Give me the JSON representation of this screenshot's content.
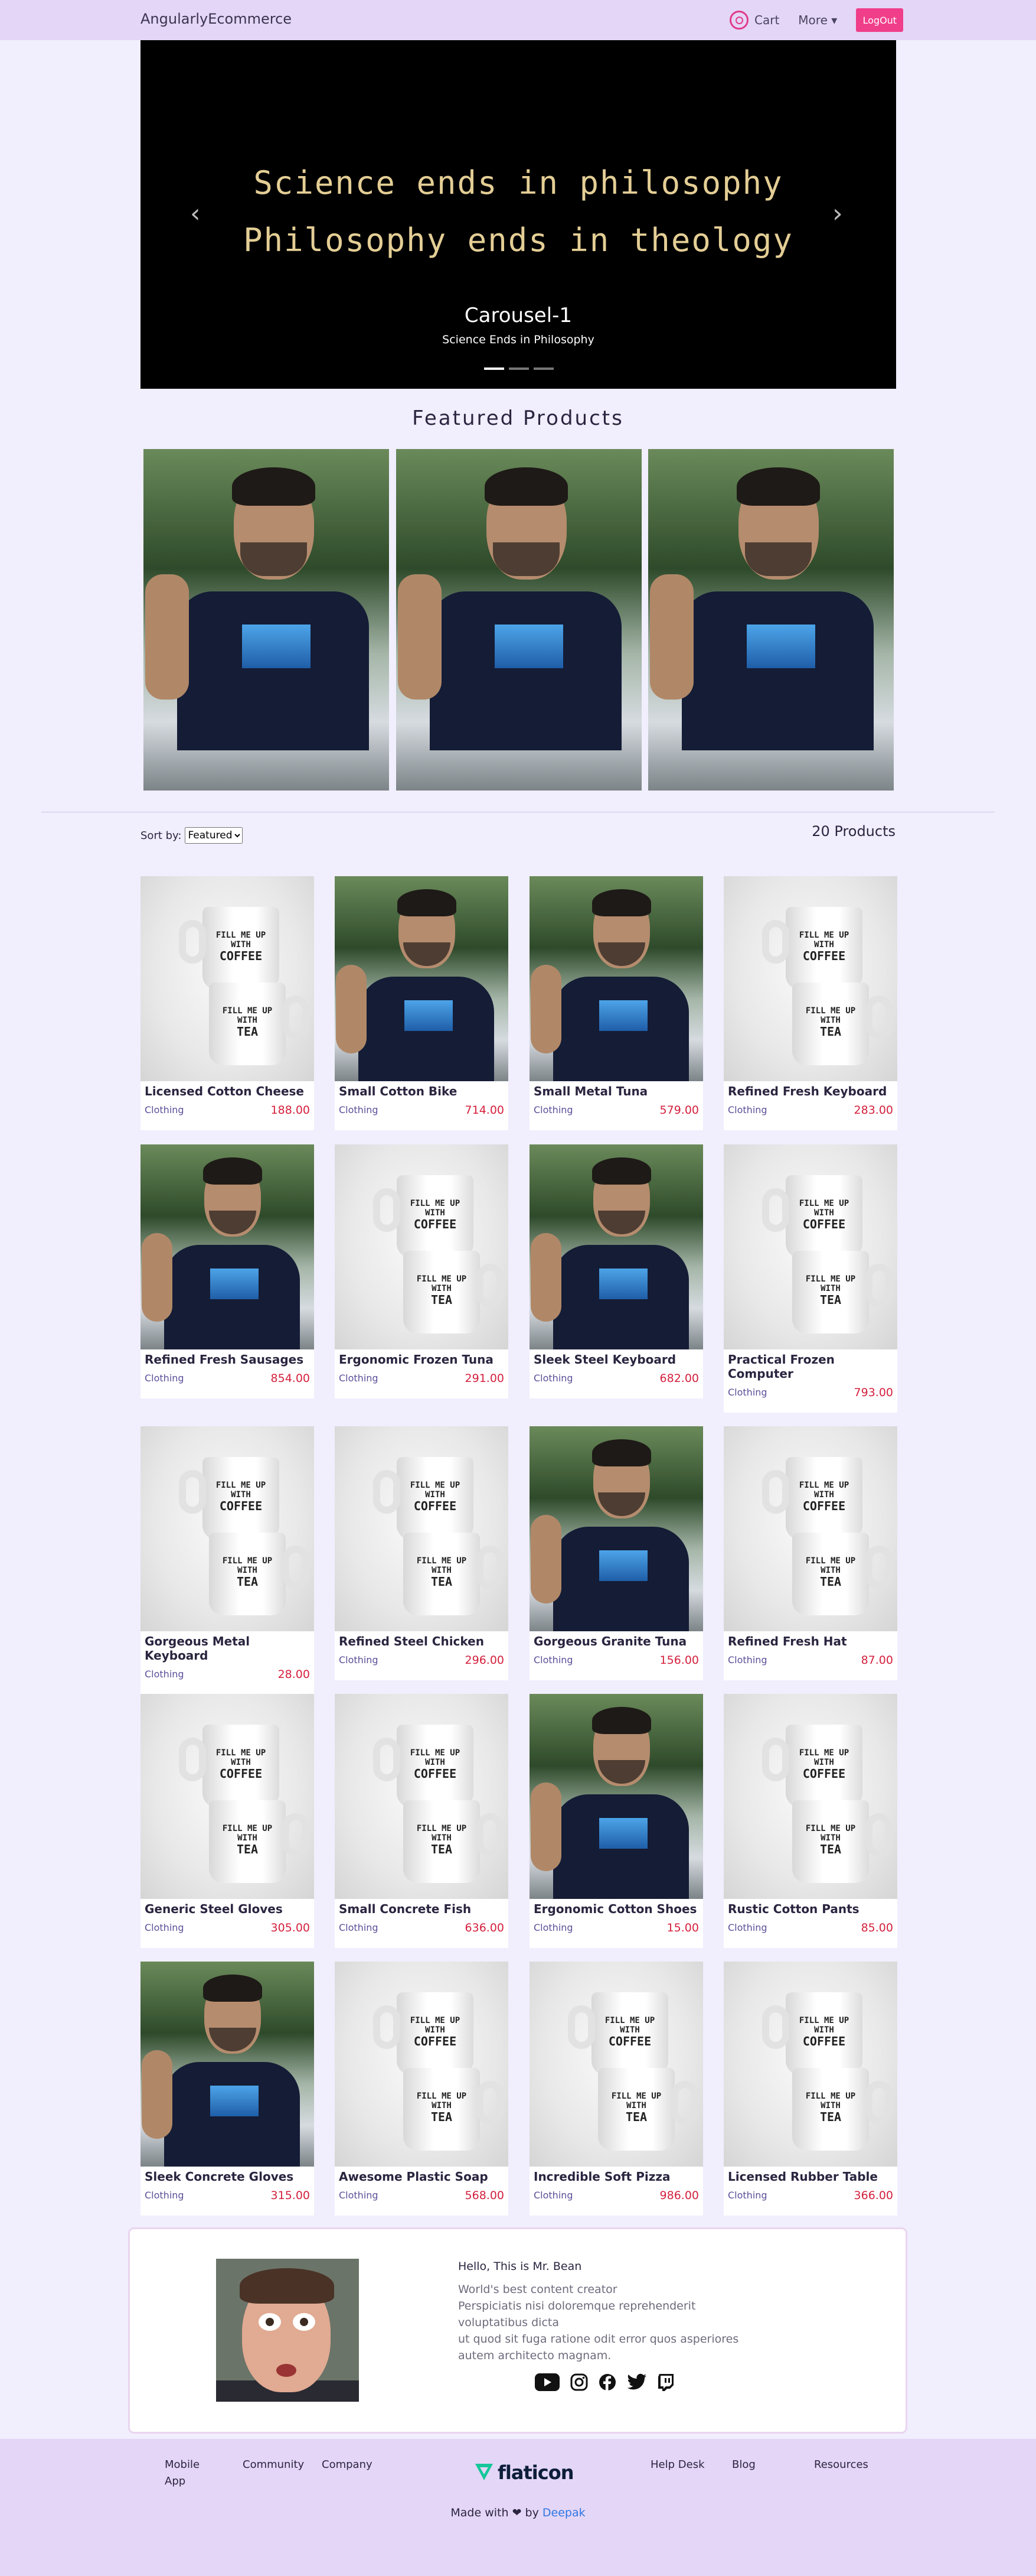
{
  "navbar": {
    "brand": "AngularlyEcommerce",
    "cart_label": "Cart",
    "more_label": "More ▾",
    "logout_label": "LogOut"
  },
  "carousel": {
    "line1": "Science ends in philosophy",
    "line2": "Philosophy ends in theology",
    "title": "Carousel-1",
    "subtitle": "Science Ends in Philosophy",
    "prev": "‹",
    "next": "›",
    "indicators": 3,
    "active_indicator": 1
  },
  "featured": {
    "title": "Featured Products",
    "items": [
      {
        "image": "person"
      },
      {
        "image": "person"
      },
      {
        "image": "person"
      }
    ]
  },
  "sort": {
    "label": "Sort by:",
    "selected": "Featured"
  },
  "product_count": "20 Products",
  "products": [
    {
      "name": "Licensed Cotton Cheese",
      "category": "Clothing",
      "price": "188.00",
      "image": "mug"
    },
    {
      "name": "Small Cotton Bike",
      "category": "Clothing",
      "price": "714.00",
      "image": "person"
    },
    {
      "name": "Small Metal Tuna",
      "category": "Clothing",
      "price": "579.00",
      "image": "person"
    },
    {
      "name": "Refined Fresh Keyboard",
      "category": "Clothing",
      "price": "283.00",
      "image": "mug"
    },
    {
      "name": "Refined Fresh Sausages",
      "category": "Clothing",
      "price": "854.00",
      "image": "person"
    },
    {
      "name": "Ergonomic Frozen Tuna",
      "category": "Clothing",
      "price": "291.00",
      "image": "mug"
    },
    {
      "name": "Sleek Steel Keyboard",
      "category": "Clothing",
      "price": "682.00",
      "image": "person"
    },
    {
      "name": "Practical Frozen Computer",
      "category": "Clothing",
      "price": "793.00",
      "image": "mug"
    },
    {
      "name": "Gorgeous Metal Keyboard",
      "category": "Clothing",
      "price": "28.00",
      "image": "mug"
    },
    {
      "name": "Refined Steel Chicken",
      "category": "Clothing",
      "price": "296.00",
      "image": "mug"
    },
    {
      "name": "Gorgeous Granite Tuna",
      "category": "Clothing",
      "price": "156.00",
      "image": "person"
    },
    {
      "name": "Refined Fresh Hat",
      "category": "Clothing",
      "price": "87.00",
      "image": "mug"
    },
    {
      "name": "Generic Steel Gloves",
      "category": "Clothing",
      "price": "305.00",
      "image": "mug"
    },
    {
      "name": "Small Concrete Fish",
      "category": "Clothing",
      "price": "636.00",
      "image": "mug"
    },
    {
      "name": "Ergonomic Cotton Shoes",
      "category": "Clothing",
      "price": "15.00",
      "image": "person"
    },
    {
      "name": "Rustic Cotton Pants",
      "category": "Clothing",
      "price": "85.00",
      "image": "mug"
    },
    {
      "name": "Sleek Concrete Gloves",
      "category": "Clothing",
      "price": "315.00",
      "image": "person"
    },
    {
      "name": "Awesome Plastic Soap",
      "category": "Clothing",
      "price": "568.00",
      "image": "mug"
    },
    {
      "name": "Incredible Soft Pizza",
      "category": "Clothing",
      "price": "986.00",
      "image": "mug"
    },
    {
      "name": "Licensed Rubber Table",
      "category": "Clothing",
      "price": "366.00",
      "image": "mug"
    }
  ],
  "mug_text": {
    "top_l1": "FILL ME UP",
    "top_l2": "WITH",
    "top_l3": "COFFEE",
    "bot_l1": "FILL ME UP",
    "bot_l2": "WITH",
    "bot_l3": "TEA"
  },
  "about": {
    "greeting": "Hello, This is Mr. Bean",
    "lines": [
      "World's best content creator",
      "Perspiciatis nisi doloremque reprehenderit",
      "voluptatibus dicta",
      "ut quod sit fuga ratione odit error quos asperiores",
      "autem architecto magnam."
    ],
    "socials": [
      "youtube-icon",
      "instagram-icon",
      "facebook-icon",
      "twitter-icon",
      "twitch-icon"
    ]
  },
  "footer": {
    "links_left": [
      "Mobile\nApp",
      "Community",
      "Company"
    ],
    "logo_text": "flaticon",
    "links_right": [
      "Help Desk",
      "Blog",
      "Resources"
    ],
    "made_with": "Made with",
    "made_by": "by",
    "author": "Deepak"
  },
  "colors": {
    "page_bg": "#f1eefd",
    "nav_bg": "#e4d6f6",
    "logout_bg": "#f03e8a",
    "price": "#d4203d",
    "category": "#5a5098",
    "author_link": "#2f77e3",
    "carousel_text": "#e4ce95"
  }
}
